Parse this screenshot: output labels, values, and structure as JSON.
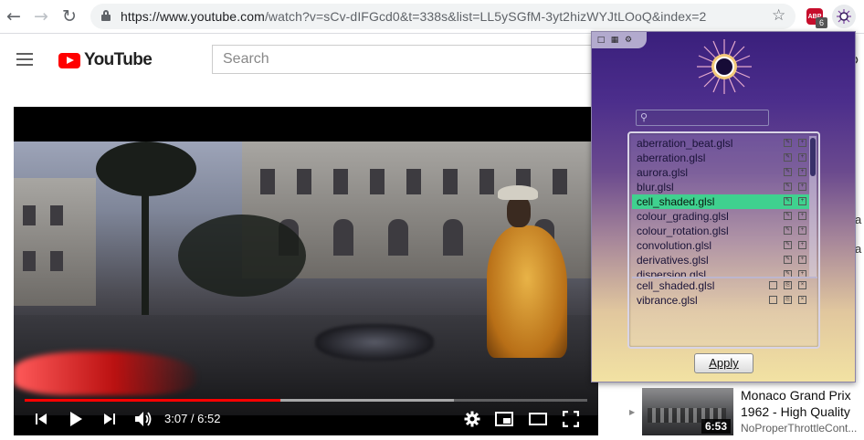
{
  "browser": {
    "url_host": "https://www.youtube.com",
    "url_path": "/watch?v=sCv-dIFGcd0&t=338s&list=LL5ySGfM-3yt2hizWYJtLOoQ&index=2",
    "abp_label": "ABP",
    "abp_count": "6"
  },
  "youtube": {
    "logo_text": "YouTube",
    "search_placeholder": "Search"
  },
  "player": {
    "time": "3:07 / 6:52",
    "played_fraction": 0.454,
    "loaded_fraction": 0.763
  },
  "suggestion": {
    "title": "Monaco Grand Prix 1962 - High Quality",
    "channel": "NoProperThrottleCont...",
    "duration": "6:53",
    "side_letter_1": "a",
    "side_letter_2": "a"
  },
  "shader_popup": {
    "available": [
      "aberration_beat.glsl",
      "aberration.glsl",
      "aurora.glsl",
      "blur.glsl",
      "cell_shaded.glsl",
      "colour_grading.glsl",
      "colour_rotation.glsl",
      "convolution.glsl",
      "derivatives.glsl",
      "dispersion.glsl"
    ],
    "selected_index": 4,
    "active": [
      "cell_shaded.glsl",
      "vibrance.glsl"
    ],
    "apply_label": "Apply",
    "highlight_color": "#3fd18f"
  }
}
